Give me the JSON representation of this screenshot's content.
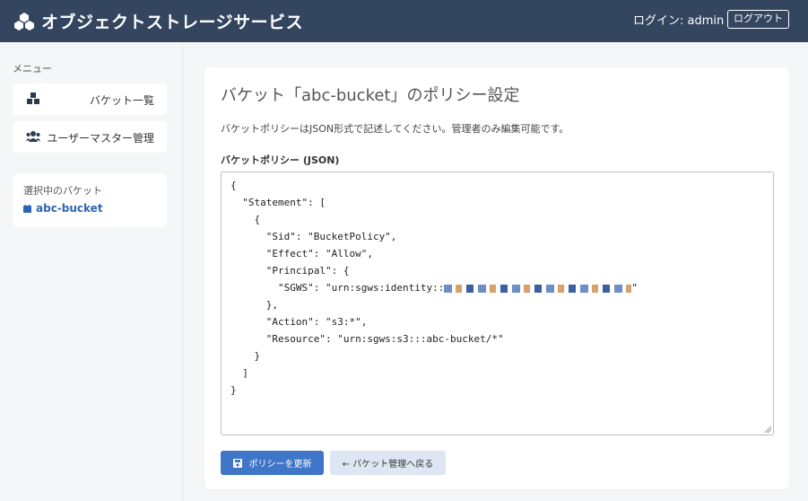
{
  "header": {
    "title": "オブジェクトストレージサービス",
    "login_text": "ログイン: admin",
    "logout_label": "ログアウト",
    "background_color": "#33455f"
  },
  "sidebar": {
    "menu_title": "メニュー",
    "items": [
      {
        "label": "バケット一覧",
        "icon": "boxes-icon"
      },
      {
        "label": "ユーザーマスター管理",
        "icon": "users-icon"
      }
    ],
    "selected": {
      "label": "選択中のバケット",
      "bucket_name": "abc-bucket",
      "icon": "calendar-icon"
    }
  },
  "main": {
    "title": "バケット「abc-bucket」のポリシー設定",
    "description": "バケットポリシーはJSON形式で記述してください。管理者のみ編集可能です。",
    "field_label": "バケットポリシー (JSON)",
    "policy_lines": [
      "{",
      "  \"Statement\": [",
      "    {",
      "      \"Sid\": \"BucketPolicy\",",
      "      \"Effect\": \"Allow\",",
      "      \"Principal\": {",
      "        \"SGWS\": \"urn:sgws:identity::",
      "      },",
      "      \"Action\": \"s3:*\",",
      "      \"Resource\": \"urn:sgws:s3:::abc-bucket/*\"",
      "    }",
      "  ]",
      "}"
    ],
    "redacted_suffix": "\"",
    "update_button": "ポリシーを更新",
    "back_button": "← バケット管理へ戻る",
    "accent_color": "#3f76c8"
  }
}
